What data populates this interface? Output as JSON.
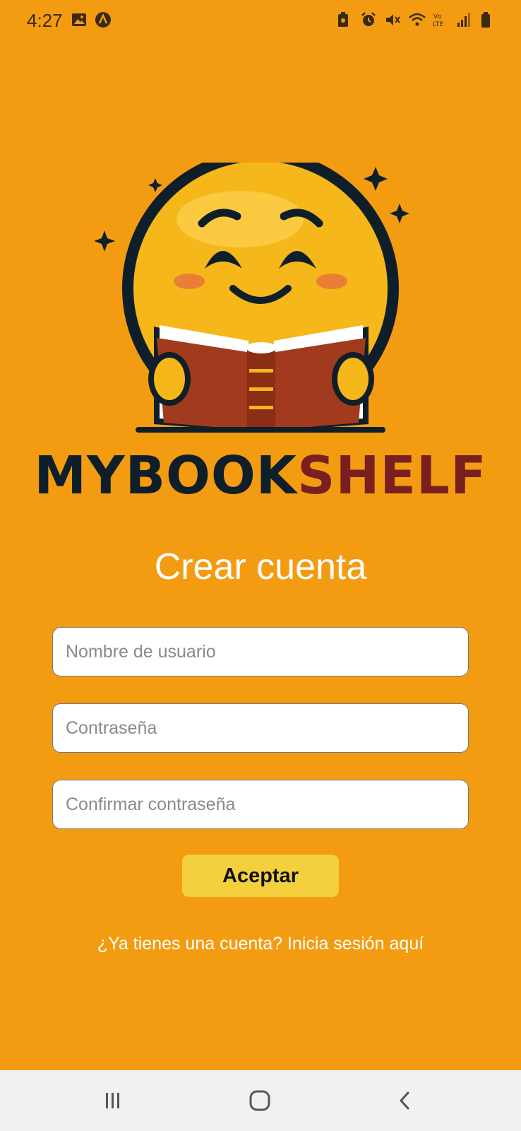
{
  "status_bar": {
    "time": "4:27",
    "left_icons": [
      "image-icon",
      "app-notification-icon"
    ],
    "right_icons": [
      "battery-saver-icon",
      "alarm-icon",
      "mute-icon",
      "wifi-icon",
      "volte-icon",
      "signal-icon",
      "battery-icon"
    ]
  },
  "logo": {
    "brand_part1": "MYBOOK",
    "brand_part2": "SHELF",
    "colors": {
      "brand_dark": "#0f1f2a",
      "brand_red": "#7a1f1f",
      "face": "#F5B719",
      "book": "#A23A1E"
    }
  },
  "form": {
    "title": "Crear cuenta",
    "username_placeholder": "Nombre de usuario",
    "password_placeholder": "Contraseña",
    "confirm_placeholder": "Confirmar contraseña",
    "accept_label": "Aceptar",
    "login_link": "¿Ya tienes una cuenta? Inicia sesión aquí"
  },
  "nav_bar": {
    "icons": [
      "recents-icon",
      "home-icon",
      "back-icon"
    ]
  },
  "colors": {
    "background": "#F39C12",
    "button": "#F4D03F",
    "navbar": "#f1f1f1"
  }
}
